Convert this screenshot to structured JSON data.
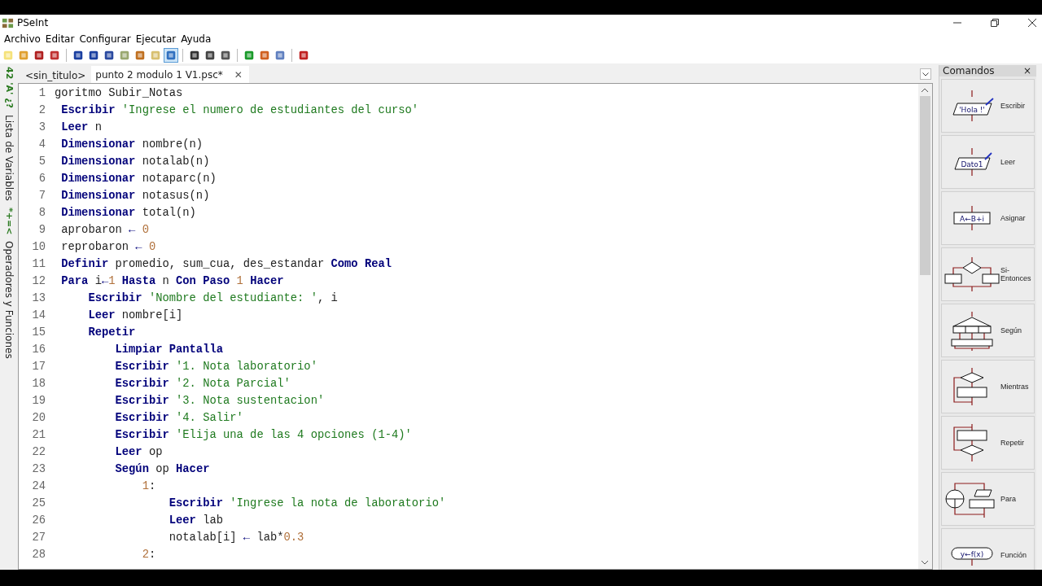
{
  "window": {
    "title": "PSeInt"
  },
  "menu": [
    "Archivo",
    "Editar",
    "Configurar",
    "Ejecutar",
    "Ayuda"
  ],
  "toolbar": [
    {
      "pressed": false
    },
    {
      "pressed": false
    },
    {
      "pressed": false
    },
    {
      "pressed": false
    },
    {
      "pressed": false
    },
    {
      "pressed": false
    },
    {
      "pressed": false
    },
    {
      "pressed": false
    },
    {
      "pressed": false
    },
    {
      "pressed": false
    },
    {
      "pressed": true
    },
    {
      "pressed": false
    },
    {
      "pressed": false
    },
    {
      "pressed": false
    },
    {
      "pressed": false
    },
    {
      "pressed": false
    },
    {
      "pressed": false
    },
    {
      "pressed": false
    }
  ],
  "side_tabs": [
    {
      "glyphs": "42 'A' ¿?",
      "label": "Lista de Variables"
    },
    {
      "glyphs": "*+=<",
      "label": "Operadores y Funciones"
    }
  ],
  "tabs": [
    {
      "label": "<sin_titulo>",
      "selected": false
    },
    {
      "label": "punto 2 modulo 1 V1.psc*",
      "selected": true,
      "close": "✕"
    }
  ],
  "code": [
    {
      "n": "1",
      "tokens": [
        {
          "kind": "plain",
          "text": "goritmo Subir_Notas"
        }
      ]
    },
    {
      "n": "2",
      "tokens": [
        {
          "kind": "kw",
          "text": " Escribir"
        },
        {
          "kind": "str",
          "text": " 'Ingrese el numero de estudiantes del curso'"
        }
      ]
    },
    {
      "n": "3",
      "tokens": [
        {
          "kind": "kw",
          "text": " Leer"
        },
        {
          "kind": "plain",
          "text": " n"
        }
      ]
    },
    {
      "n": "4",
      "tokens": [
        {
          "kind": "kw",
          "text": " Dimensionar"
        },
        {
          "kind": "plain",
          "text": " nombre(n)"
        }
      ]
    },
    {
      "n": "5",
      "tokens": [
        {
          "kind": "kw",
          "text": " Dimensionar"
        },
        {
          "kind": "plain",
          "text": " notalab(n)"
        }
      ]
    },
    {
      "n": "6",
      "tokens": [
        {
          "kind": "kw",
          "text": " Dimensionar"
        },
        {
          "kind": "plain",
          "text": " notaparc(n)"
        }
      ]
    },
    {
      "n": "7",
      "tokens": [
        {
          "kind": "kw",
          "text": " Dimensionar"
        },
        {
          "kind": "plain",
          "text": " notasus(n)"
        }
      ]
    },
    {
      "n": "8",
      "tokens": [
        {
          "kind": "kw",
          "text": " Dimensionar"
        },
        {
          "kind": "plain",
          "text": " total(n)"
        }
      ]
    },
    {
      "n": "9",
      "tokens": [
        {
          "kind": "plain",
          "text": " aprobaron "
        },
        {
          "kind": "op",
          "text": "←"
        },
        {
          "kind": "num",
          "text": " 0"
        }
      ]
    },
    {
      "n": "10",
      "tokens": [
        {
          "kind": "plain",
          "text": " reprobaron "
        },
        {
          "kind": "op",
          "text": "←"
        },
        {
          "kind": "num",
          "text": " 0"
        }
      ]
    },
    {
      "n": "11",
      "tokens": [
        {
          "kind": "kw",
          "text": " Definir"
        },
        {
          "kind": "plain",
          "text": " promedio, sum_cua, des_estandar "
        },
        {
          "kind": "kw",
          "text": "Como Real"
        }
      ]
    },
    {
      "n": "12",
      "tokens": [
        {
          "kind": "kw",
          "text": " Para"
        },
        {
          "kind": "plain",
          "text": " i"
        },
        {
          "kind": "op",
          "text": "←"
        },
        {
          "kind": "num",
          "text": "1"
        },
        {
          "kind": "kw",
          "text": " Hasta"
        },
        {
          "kind": "plain",
          "text": " n "
        },
        {
          "kind": "kw",
          "text": "Con Paso"
        },
        {
          "kind": "num",
          "text": " 1"
        },
        {
          "kind": "kw",
          "text": " Hacer"
        }
      ]
    },
    {
      "n": "13",
      "tokens": [
        {
          "kind": "kw",
          "text": "     Escribir"
        },
        {
          "kind": "str",
          "text": " 'Nombre del estudiante: '"
        },
        {
          "kind": "plain",
          "text": ", i"
        }
      ]
    },
    {
      "n": "14",
      "tokens": [
        {
          "kind": "kw",
          "text": "     Leer"
        },
        {
          "kind": "plain",
          "text": " nombre[i]"
        }
      ]
    },
    {
      "n": "15",
      "tokens": [
        {
          "kind": "kw",
          "text": "     Repetir"
        }
      ]
    },
    {
      "n": "16",
      "tokens": [
        {
          "kind": "kw",
          "text": "         Limpiar Pantalla"
        }
      ]
    },
    {
      "n": "17",
      "tokens": [
        {
          "kind": "kw",
          "text": "         Escribir"
        },
        {
          "kind": "str",
          "text": " '1. Nota laboratorio'"
        }
      ]
    },
    {
      "n": "18",
      "tokens": [
        {
          "kind": "kw",
          "text": "         Escribir"
        },
        {
          "kind": "str",
          "text": " '2. Nota Parcial'"
        }
      ]
    },
    {
      "n": "19",
      "tokens": [
        {
          "kind": "kw",
          "text": "         Escribir"
        },
        {
          "kind": "str",
          "text": " '3. Nota sustentacion'"
        }
      ]
    },
    {
      "n": "20",
      "tokens": [
        {
          "kind": "kw",
          "text": "         Escribir"
        },
        {
          "kind": "str",
          "text": " '4. Salir'"
        }
      ]
    },
    {
      "n": "21",
      "tokens": [
        {
          "kind": "kw",
          "text": "         Escribir"
        },
        {
          "kind": "str",
          "text": " 'Elija una de las 4 opciones (1-4)'"
        }
      ]
    },
    {
      "n": "22",
      "tokens": [
        {
          "kind": "kw",
          "text": "         Leer"
        },
        {
          "kind": "plain",
          "text": " op"
        }
      ]
    },
    {
      "n": "23",
      "tokens": [
        {
          "kind": "kw",
          "text": "         Según"
        },
        {
          "kind": "plain",
          "text": " op "
        },
        {
          "kind": "kw",
          "text": "Hacer"
        }
      ]
    },
    {
      "n": "24",
      "tokens": [
        {
          "kind": "num",
          "text": "             1"
        },
        {
          "kind": "plain",
          "text": ":"
        }
      ]
    },
    {
      "n": "25",
      "tokens": [
        {
          "kind": "kw",
          "text": "                 Escribir"
        },
        {
          "kind": "str",
          "text": " 'Ingrese la nota de laboratorio'"
        }
      ]
    },
    {
      "n": "26",
      "tokens": [
        {
          "kind": "kw",
          "text": "                 Leer"
        },
        {
          "kind": "plain",
          "text": " lab"
        }
      ]
    },
    {
      "n": "27",
      "tokens": [
        {
          "kind": "plain",
          "text": "                 notalab[i] "
        },
        {
          "kind": "op",
          "text": "←"
        },
        {
          "kind": "plain",
          "text": " lab*"
        },
        {
          "kind": "num",
          "text": "0.3"
        }
      ]
    },
    {
      "n": "28",
      "tokens": [
        {
          "kind": "num",
          "text": "             2"
        },
        {
          "kind": "plain",
          "text": ":"
        }
      ]
    }
  ],
  "panel": {
    "title": "Comandos",
    "close": "×",
    "commands": [
      {
        "kind": "escribir",
        "label": "Escribir",
        "texts": [
          "'Hola !'"
        ]
      },
      {
        "kind": "leer",
        "label": "Leer",
        "texts": [
          "Dato1"
        ]
      },
      {
        "kind": "asignar",
        "label": "Asignar",
        "texts": [
          "A←B+i"
        ]
      },
      {
        "kind": "si",
        "label": "Si-Entonces"
      },
      {
        "kind": "segun",
        "label": "Según"
      },
      {
        "kind": "mientras",
        "label": "Mientras"
      },
      {
        "kind": "repetir",
        "label": "Repetir"
      },
      {
        "kind": "para",
        "label": "Para"
      },
      {
        "kind": "funcion",
        "label": "Función",
        "texts": [
          "y←f(x)"
        ]
      }
    ]
  }
}
